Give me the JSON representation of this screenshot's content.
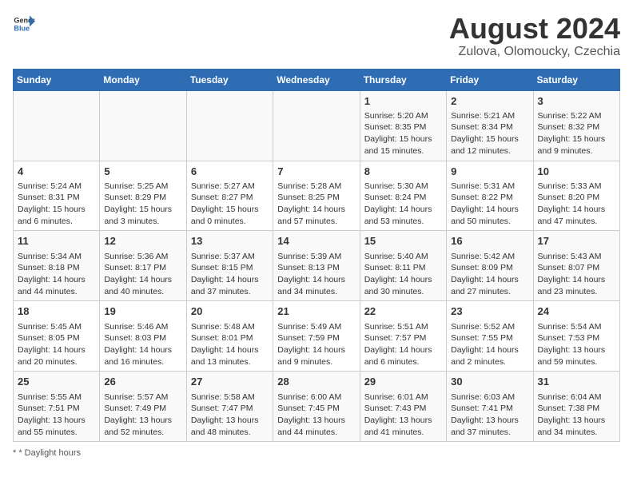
{
  "header": {
    "logo_general": "General",
    "logo_blue": "Blue",
    "main_title": "August 2024",
    "subtitle": "Zulova, Olomoucky, Czechia"
  },
  "footer": {
    "note": "* Daylight hours"
  },
  "weekdays": [
    "Sunday",
    "Monday",
    "Tuesday",
    "Wednesday",
    "Thursday",
    "Friday",
    "Saturday"
  ],
  "weeks": [
    [
      {
        "day": "",
        "info": ""
      },
      {
        "day": "",
        "info": ""
      },
      {
        "day": "",
        "info": ""
      },
      {
        "day": "",
        "info": ""
      },
      {
        "day": "1",
        "info": "Sunrise: 5:20 AM\nSunset: 8:35 PM\nDaylight: 15 hours and 15 minutes."
      },
      {
        "day": "2",
        "info": "Sunrise: 5:21 AM\nSunset: 8:34 PM\nDaylight: 15 hours and 12 minutes."
      },
      {
        "day": "3",
        "info": "Sunrise: 5:22 AM\nSunset: 8:32 PM\nDaylight: 15 hours and 9 minutes."
      }
    ],
    [
      {
        "day": "4",
        "info": "Sunrise: 5:24 AM\nSunset: 8:31 PM\nDaylight: 15 hours and 6 minutes."
      },
      {
        "day": "5",
        "info": "Sunrise: 5:25 AM\nSunset: 8:29 PM\nDaylight: 15 hours and 3 minutes."
      },
      {
        "day": "6",
        "info": "Sunrise: 5:27 AM\nSunset: 8:27 PM\nDaylight: 15 hours and 0 minutes."
      },
      {
        "day": "7",
        "info": "Sunrise: 5:28 AM\nSunset: 8:25 PM\nDaylight: 14 hours and 57 minutes."
      },
      {
        "day": "8",
        "info": "Sunrise: 5:30 AM\nSunset: 8:24 PM\nDaylight: 14 hours and 53 minutes."
      },
      {
        "day": "9",
        "info": "Sunrise: 5:31 AM\nSunset: 8:22 PM\nDaylight: 14 hours and 50 minutes."
      },
      {
        "day": "10",
        "info": "Sunrise: 5:33 AM\nSunset: 8:20 PM\nDaylight: 14 hours and 47 minutes."
      }
    ],
    [
      {
        "day": "11",
        "info": "Sunrise: 5:34 AM\nSunset: 8:18 PM\nDaylight: 14 hours and 44 minutes."
      },
      {
        "day": "12",
        "info": "Sunrise: 5:36 AM\nSunset: 8:17 PM\nDaylight: 14 hours and 40 minutes."
      },
      {
        "day": "13",
        "info": "Sunrise: 5:37 AM\nSunset: 8:15 PM\nDaylight: 14 hours and 37 minutes."
      },
      {
        "day": "14",
        "info": "Sunrise: 5:39 AM\nSunset: 8:13 PM\nDaylight: 14 hours and 34 minutes."
      },
      {
        "day": "15",
        "info": "Sunrise: 5:40 AM\nSunset: 8:11 PM\nDaylight: 14 hours and 30 minutes."
      },
      {
        "day": "16",
        "info": "Sunrise: 5:42 AM\nSunset: 8:09 PM\nDaylight: 14 hours and 27 minutes."
      },
      {
        "day": "17",
        "info": "Sunrise: 5:43 AM\nSunset: 8:07 PM\nDaylight: 14 hours and 23 minutes."
      }
    ],
    [
      {
        "day": "18",
        "info": "Sunrise: 5:45 AM\nSunset: 8:05 PM\nDaylight: 14 hours and 20 minutes."
      },
      {
        "day": "19",
        "info": "Sunrise: 5:46 AM\nSunset: 8:03 PM\nDaylight: 14 hours and 16 minutes."
      },
      {
        "day": "20",
        "info": "Sunrise: 5:48 AM\nSunset: 8:01 PM\nDaylight: 14 hours and 13 minutes."
      },
      {
        "day": "21",
        "info": "Sunrise: 5:49 AM\nSunset: 7:59 PM\nDaylight: 14 hours and 9 minutes."
      },
      {
        "day": "22",
        "info": "Sunrise: 5:51 AM\nSunset: 7:57 PM\nDaylight: 14 hours and 6 minutes."
      },
      {
        "day": "23",
        "info": "Sunrise: 5:52 AM\nSunset: 7:55 PM\nDaylight: 14 hours and 2 minutes."
      },
      {
        "day": "24",
        "info": "Sunrise: 5:54 AM\nSunset: 7:53 PM\nDaylight: 13 hours and 59 minutes."
      }
    ],
    [
      {
        "day": "25",
        "info": "Sunrise: 5:55 AM\nSunset: 7:51 PM\nDaylight: 13 hours and 55 minutes."
      },
      {
        "day": "26",
        "info": "Sunrise: 5:57 AM\nSunset: 7:49 PM\nDaylight: 13 hours and 52 minutes."
      },
      {
        "day": "27",
        "info": "Sunrise: 5:58 AM\nSunset: 7:47 PM\nDaylight: 13 hours and 48 minutes."
      },
      {
        "day": "28",
        "info": "Sunrise: 6:00 AM\nSunset: 7:45 PM\nDaylight: 13 hours and 44 minutes."
      },
      {
        "day": "29",
        "info": "Sunrise: 6:01 AM\nSunset: 7:43 PM\nDaylight: 13 hours and 41 minutes."
      },
      {
        "day": "30",
        "info": "Sunrise: 6:03 AM\nSunset: 7:41 PM\nDaylight: 13 hours and 37 minutes."
      },
      {
        "day": "31",
        "info": "Sunrise: 6:04 AM\nSunset: 7:38 PM\nDaylight: 13 hours and 34 minutes."
      }
    ]
  ]
}
